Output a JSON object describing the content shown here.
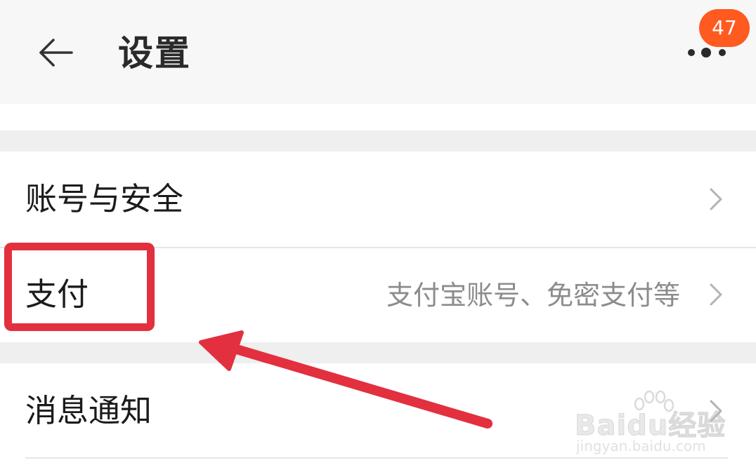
{
  "header": {
    "title": "设置",
    "back_icon": "arrow-left-icon",
    "more_icon": "more-dots-icon",
    "badge_count": "47",
    "badge_color": "#ff5a1f"
  },
  "settings": {
    "items": [
      {
        "label": "账号与安全",
        "description": "",
        "icon": "chevron-right-icon"
      },
      {
        "label": "支付",
        "description": "支付宝账号、免密支付等",
        "icon": "chevron-right-icon"
      },
      {
        "label": "消息通知",
        "description": "",
        "icon": "chevron-right-icon"
      }
    ]
  },
  "annotation": {
    "highlight_color": "#e2303f",
    "arrow_color": "#e2303f"
  },
  "watermark": {
    "brand": "Baidu经验",
    "url": "jingyan.baidu.com"
  }
}
